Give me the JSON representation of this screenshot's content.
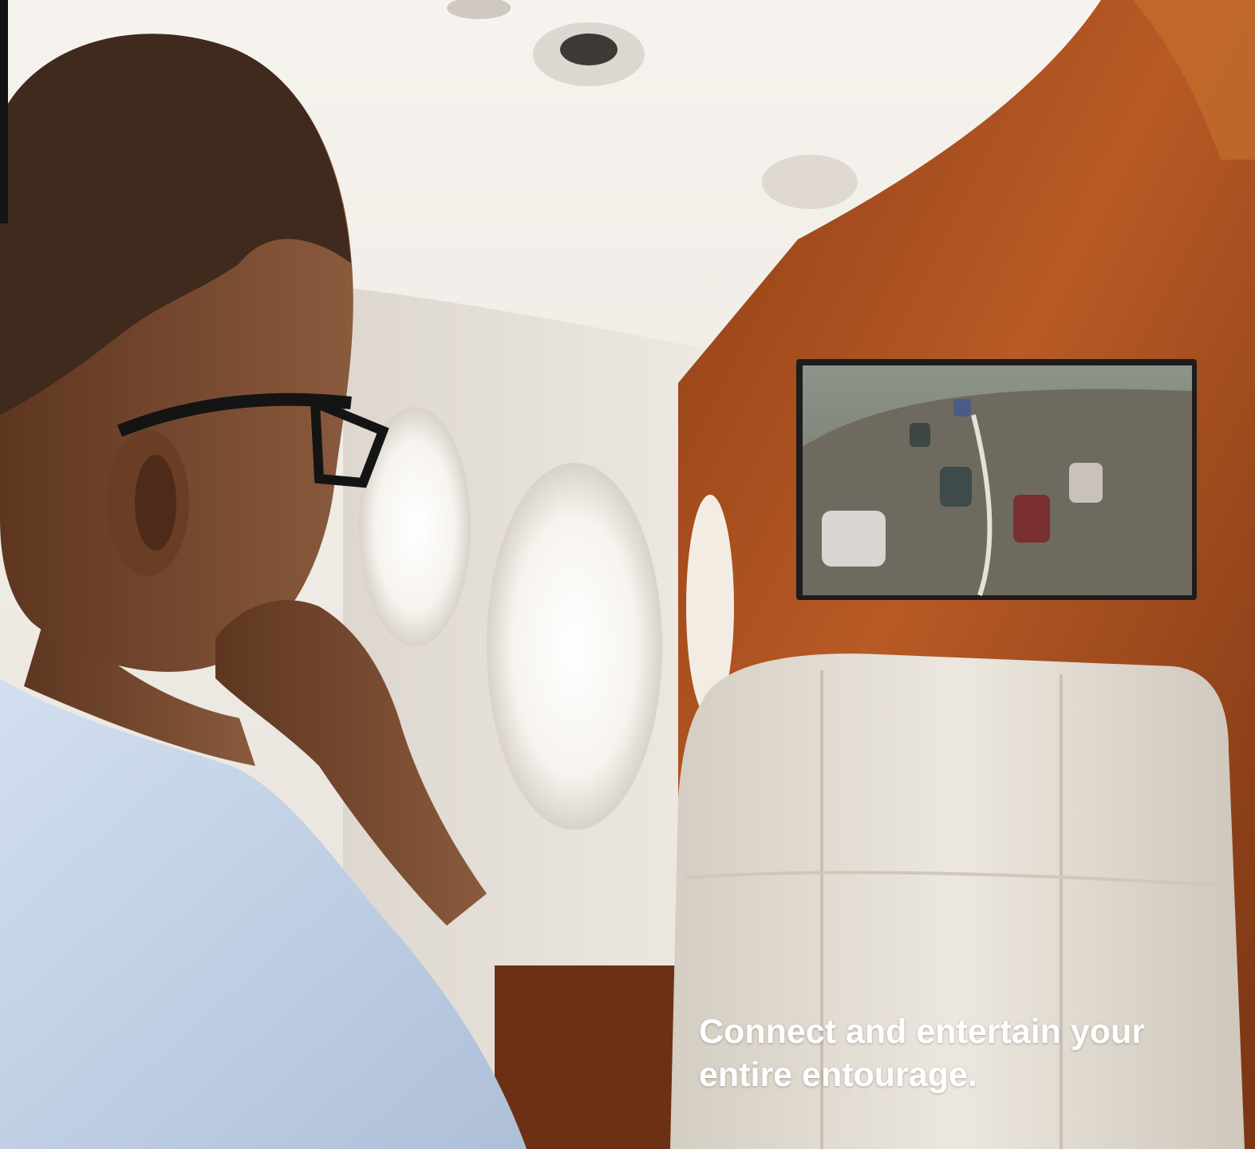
{
  "caption": {
    "line1": "Connect and entertain your",
    "line2": "entire entourage."
  },
  "scene_colors": {
    "ceiling": "#efebe6",
    "wood_panel": "#a9501f",
    "seat_leather": "#e4ded5",
    "shirt": "#c2d3ea",
    "skin": "#7a4b30",
    "hair": "#3f2a1d"
  }
}
